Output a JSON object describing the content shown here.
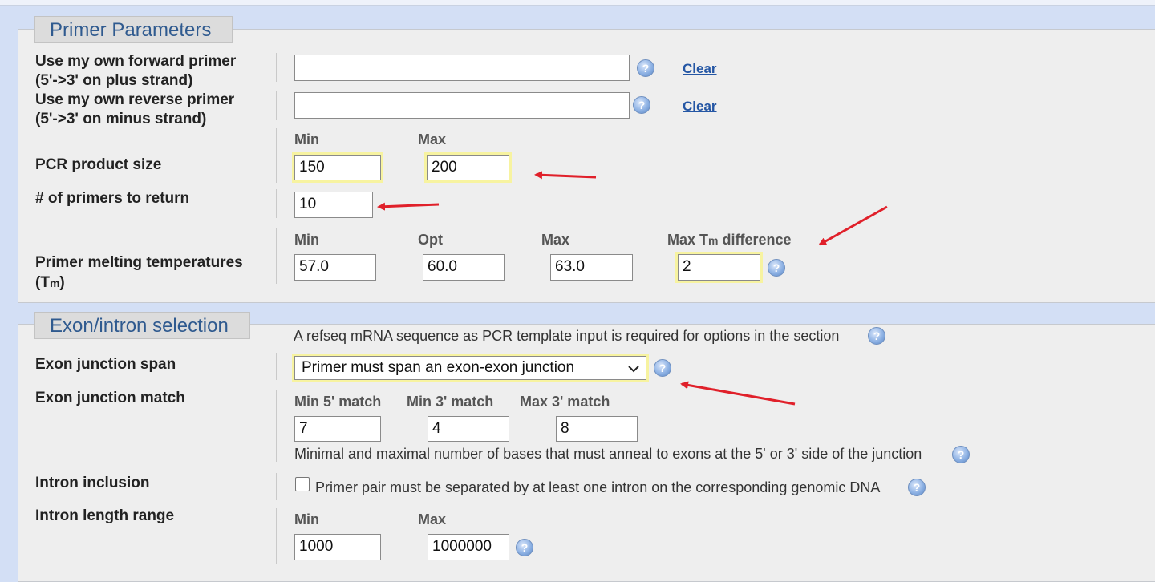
{
  "primer_section": {
    "title": "Primer Parameters",
    "forward": {
      "label1": "Use my own forward primer",
      "label2": "(5'->3' on plus strand)",
      "value": "",
      "clear": "Clear"
    },
    "reverse": {
      "label1": "Use my own reverse primer",
      "label2": "(5'->3' on minus strand)",
      "value": "",
      "clear": "Clear"
    },
    "product_size": {
      "label": "PCR product size",
      "min_head": "Min",
      "max_head": "Max",
      "min": "150",
      "max": "200"
    },
    "num_primers": {
      "label": "# of primers to return",
      "value": "10"
    },
    "melting": {
      "label1": "Primer melting temperatures",
      "label2_a": "(T",
      "label2_b": "m",
      "label2_c": ")",
      "min_head": "Min",
      "opt_head": "Opt",
      "max_head": "Max",
      "diff_head_a": "Max T",
      "diff_head_b": "m",
      "diff_head_c": " difference",
      "min": "57.0",
      "opt": "60.0",
      "max": "63.0",
      "diff": "2"
    }
  },
  "exon_section": {
    "title": "Exon/intron selection",
    "note": "A refseq mRNA sequence as PCR template input is required for options in the section",
    "junction_span": {
      "label": "Exon junction span",
      "selected": "Primer must span an exon-exon junction"
    },
    "junction_match": {
      "label": "Exon junction match",
      "min5_head": "Min 5' match",
      "min3_head": "Min 3' match",
      "max3_head": "Max 3' match",
      "min5": "7",
      "min3": "4",
      "max3": "8",
      "note": "Minimal and maximal number of bases that must anneal to exons at the 5' or 3' side of the junction"
    },
    "intron_inclusion": {
      "label": "Intron inclusion",
      "checkbox_label": "Primer pair must be separated by at least one intron on the corresponding genomic DNA",
      "checked": false
    },
    "intron_length": {
      "label": "Intron length range",
      "min_head": "Min",
      "max_head": "Max",
      "min": "1000",
      "max": "1000000"
    }
  },
  "icons": {
    "help": "help-icon",
    "arrow": "red-arrow-annotation",
    "dropdown": "chevron-down-icon"
  },
  "colors": {
    "background": "#d3dff5",
    "panel": "#eeeeee",
    "legend_text": "#2f5a8f",
    "highlight": "#f7f3a0",
    "arrow": "#e0202a"
  }
}
